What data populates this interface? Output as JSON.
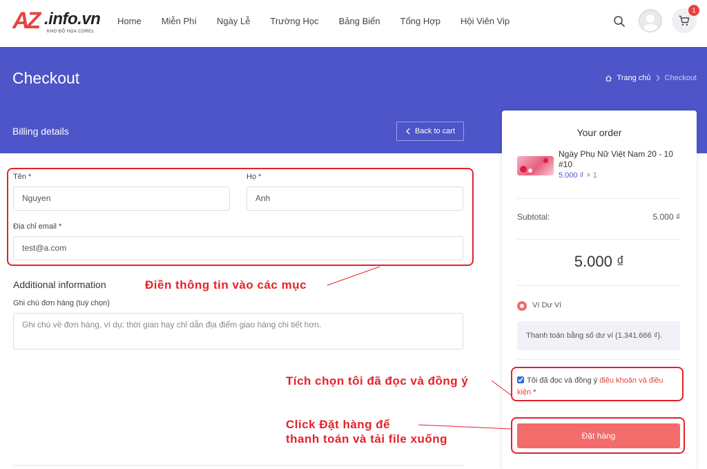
{
  "header": {
    "logo_mark": "AZ",
    "logo_name": ".info.vn",
    "logo_tagline": "KHO ĐỒ HỌA COREL",
    "nav": [
      "Home",
      "Miễn Phí",
      "Ngày Lễ",
      "Trường Học",
      "Bảng Biển",
      "Tổng Hợp",
      "Hội Viên Vip"
    ],
    "cart_count": "1"
  },
  "hero": {
    "title": "Checkout",
    "breadcrumb_home": "Trang chủ",
    "breadcrumb_current": "Checkout",
    "billing_title": "Billing details",
    "back_label": "Back to cart"
  },
  "form": {
    "first_name_label": "Tên *",
    "first_name_value": "Nguyen",
    "last_name_label": "Họ *",
    "last_name_value": "Anh",
    "email_label": "Địa chỉ email *",
    "email_value": "test@a.com",
    "additional_title": "Additional information",
    "notes_label": "Ghi chú đơn hàng (tuỳ chọn)",
    "notes_placeholder": "Ghi chú về đơn hàng, ví dụ: thời gian hay chỉ dẫn địa điểm giao hàng chi tiết hơn."
  },
  "order": {
    "title": "Your order",
    "product_name": "Ngày Phụ Nữ Việt Nam 20 - 10 #10",
    "product_price": "5.000 ₫",
    "product_qty": "× 1",
    "subtotal_label": "Subtotal:",
    "subtotal_value": "5.000 ₫",
    "total": "5.000 ₫",
    "payment_method": "Ví Dư Ví",
    "payment_desc": "Thanh toán bằng số dư ví (1.341.666 ₫).",
    "terms_text": "Tôi đã đọc và đồng ý",
    "terms_link": "điều khoản và điều kiện",
    "terms_required": "*",
    "place_order": "Đặt hàng"
  },
  "annotations": {
    "fill_info": "Điền thông tin vào các mục",
    "tick_agree": "Tích chọn tôi đã đọc và đồng ý",
    "click_order_1": "Click Đặt hàng để",
    "click_order_2": "thanh toán và tải file xuống"
  },
  "colors": {
    "brand": "#4d55c8",
    "accent": "#f36b6a",
    "annotation": "#e5202a"
  }
}
